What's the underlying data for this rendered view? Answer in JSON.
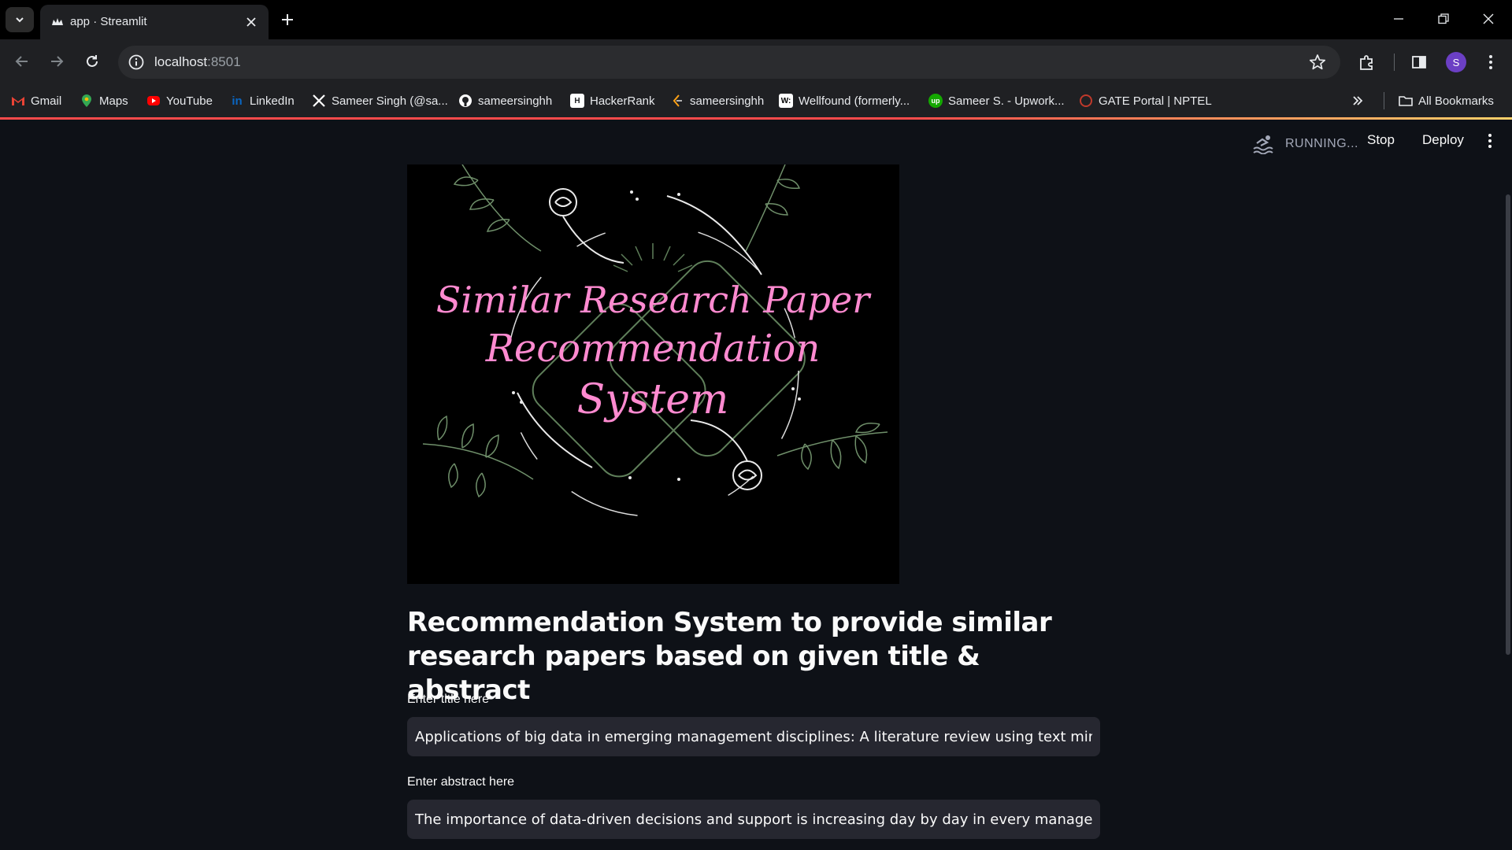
{
  "browser": {
    "tab_title": "app · Streamlit",
    "url_host": "localhost",
    "url_port": ":8501",
    "profile_initial": "S",
    "bookmarks": [
      {
        "label": "Gmail",
        "icon": "gmail-icon",
        "color": "#ea4335"
      },
      {
        "label": "Maps",
        "icon": "maps-icon",
        "color": "#34a853"
      },
      {
        "label": "YouTube",
        "icon": "youtube-icon",
        "color": "#ff0000"
      },
      {
        "label": "LinkedIn",
        "icon": "linkedin-icon",
        "color": "#0a66c2"
      },
      {
        "label": "Sameer Singh (@sa...",
        "icon": "x-icon",
        "color": "#ffffff"
      },
      {
        "label": "sameersinghh",
        "icon": "github-icon",
        "color": "#ffffff"
      },
      {
        "label": "HackerRank",
        "icon": "hackerrank-icon",
        "color": "#1ba94c"
      },
      {
        "label": "sameersinghh",
        "icon": "leetcode-icon",
        "color": "#ffa116"
      },
      {
        "label": "Wellfound (formerly...",
        "icon": "wellfound-icon",
        "color": "#ffffff"
      },
      {
        "label": "Sameer S. - Upwork...",
        "icon": "upwork-icon",
        "color": "#14a800"
      },
      {
        "label": "GATE Portal | NPTEL",
        "icon": "nptel-icon",
        "color": "#c0392b"
      }
    ],
    "all_bookmarks": "All Bookmarks"
  },
  "app": {
    "status": "RUNNING...",
    "stop_label": "Stop",
    "deploy_label": "Deploy",
    "hero_lines": [
      "Similar Research Paper",
      "Recommendation",
      "System"
    ],
    "title": "Recommendation System to provide similar research papers based on given title & abstract",
    "title_label": "Enter title here",
    "title_value": "Applications of big data in emerging management disciplines: A literature review using text mining",
    "abstract_label": "Enter abstract here",
    "abstract_value": "The importance of data-driven decisions and support is increasing day by day in every management area. Constant access to"
  },
  "colors": {
    "app_bg": "#0e1117",
    "input_bg": "#262730",
    "accent": "#ff4b4b",
    "hero_text": "#ff8ad0",
    "leaf": "#6f8f6a"
  }
}
